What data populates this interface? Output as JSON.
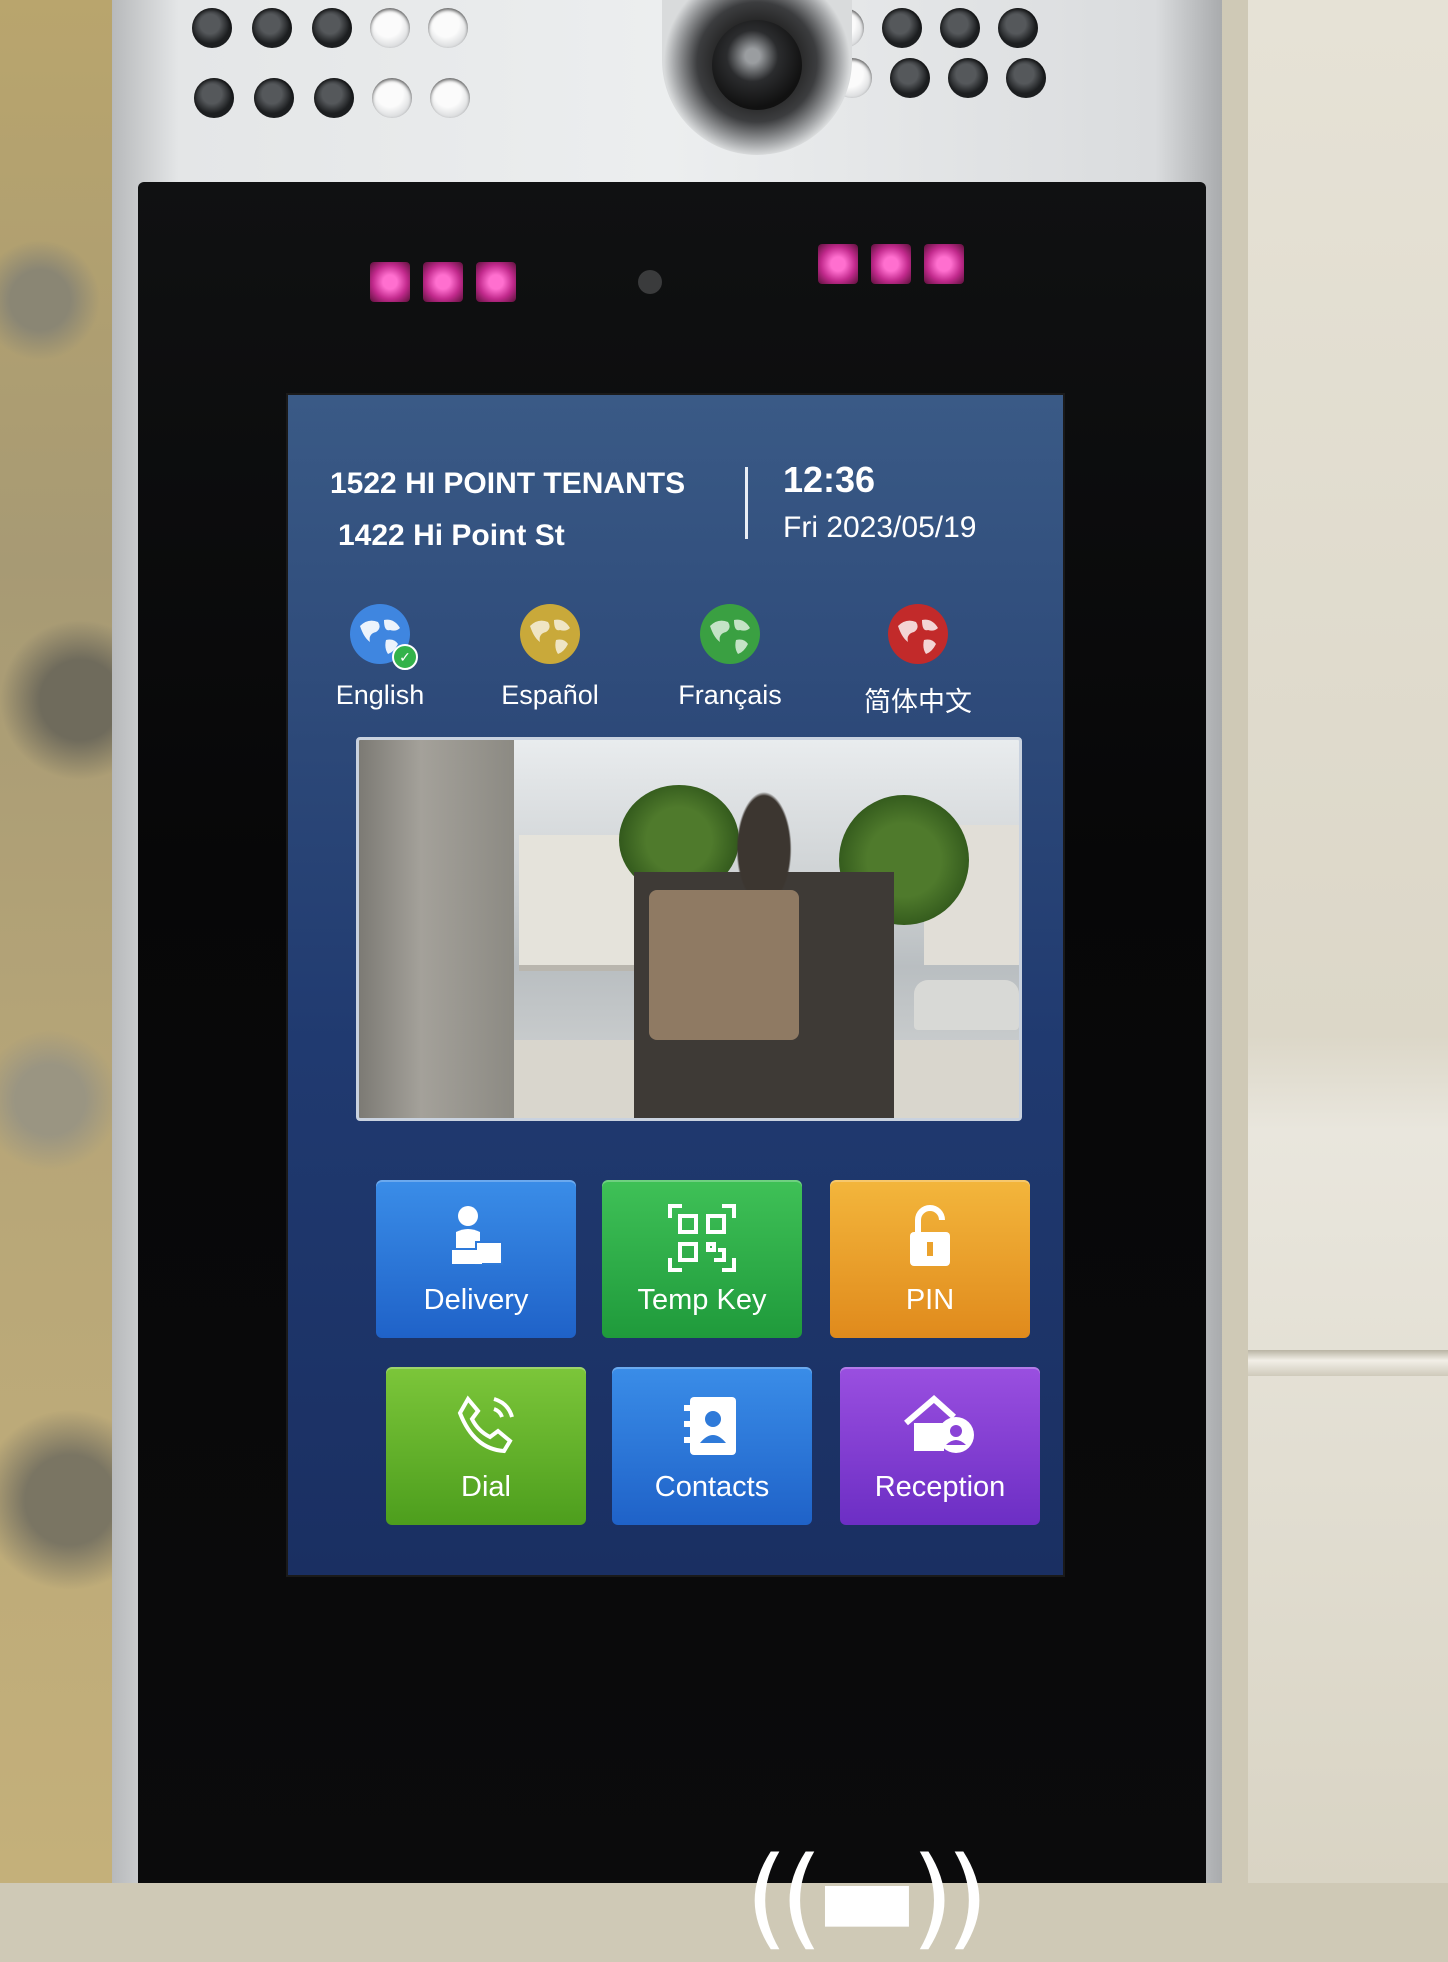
{
  "header": {
    "title": "1522 HI POINT TENANTS",
    "address": "1422 Hi Point St",
    "time": "12:36",
    "date": "Fri 2023/05/19"
  },
  "languages": [
    {
      "label": "English",
      "globe_color": "#3f86e0",
      "selected": true
    },
    {
      "label": "Español",
      "globe_color": "#c9a93a",
      "selected": false
    },
    {
      "label": "Français",
      "globe_color": "#3aa042",
      "selected": false
    },
    {
      "label": "简体中文",
      "globe_color": "#c22a2a",
      "selected": false
    }
  ],
  "actions": [
    {
      "label": "Delivery",
      "icon": "delivery-person-icon",
      "color": "#2f7ad9"
    },
    {
      "label": "Temp Key",
      "icon": "qr-code-icon",
      "color": "#2eae48"
    },
    {
      "label": "PIN",
      "icon": "unlock-icon",
      "color": "#eba22c"
    },
    {
      "label": "Dial",
      "icon": "phone-call-icon",
      "color": "#66b22b"
    },
    {
      "label": "Contacts",
      "icon": "contacts-book-icon",
      "color": "#2f7ad9"
    },
    {
      "label": "Reception",
      "icon": "house-person-icon",
      "color": "#8a42d6"
    }
  ],
  "nfc_reader": {
    "icon": "nfc-icon",
    "glyph": "((▬))"
  },
  "colors": {
    "screen_bg": "#2a4577",
    "ir_led": "#e0459f"
  }
}
